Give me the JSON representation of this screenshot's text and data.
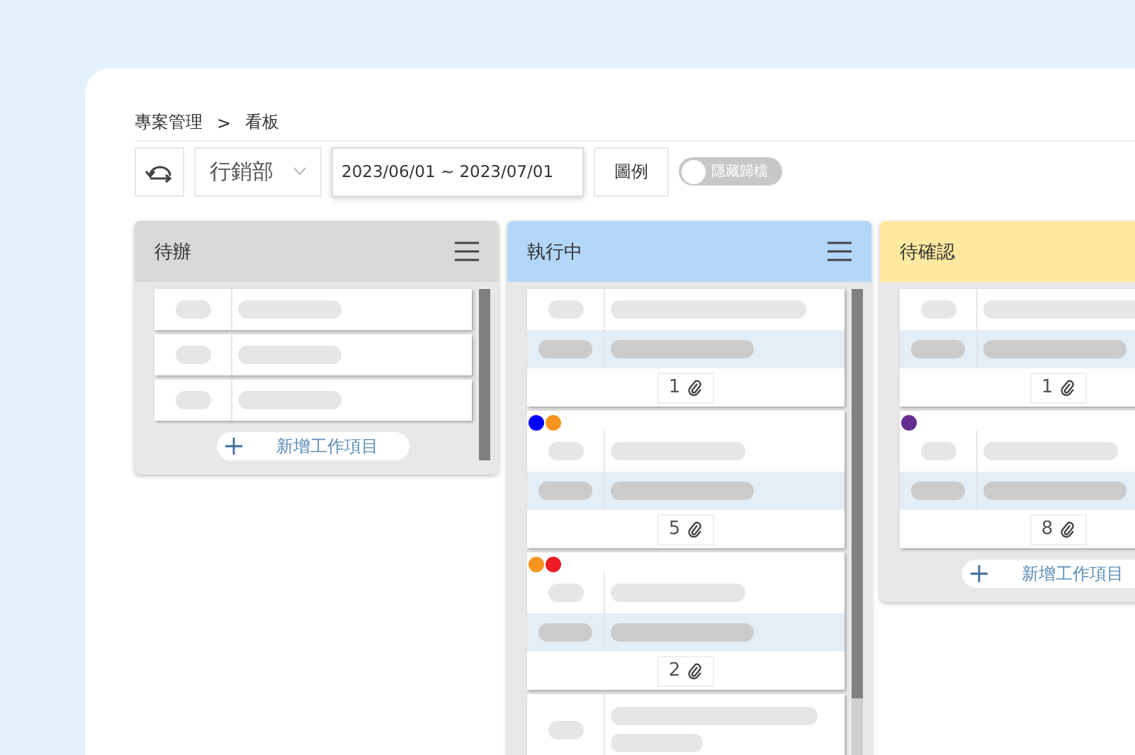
{
  "breadcrumb": {
    "items": [
      "專案管理",
      "看板"
    ],
    "separator": ">"
  },
  "toolbar": {
    "department": "行銷部",
    "date_range": "2023/06/01 ~ 2023/07/01",
    "legend_button": "圖例",
    "archive_toggle": {
      "label": "隱藏歸檔",
      "on": false
    }
  },
  "columns": [
    {
      "title": "待辦",
      "color": "#d9d9d9",
      "add_label": "新增工作項目",
      "cards": [
        {
          "kind": "simple"
        },
        {
          "kind": "simple"
        },
        {
          "kind": "simple"
        }
      ]
    },
    {
      "title": "執行中",
      "color": "#b3d7f8",
      "cards": [
        {
          "kind": "detailed",
          "attachments": "1"
        },
        {
          "kind": "detailed",
          "tags": [
            {
              "color": "#0000ff"
            },
            {
              "color": "#f7941d"
            }
          ],
          "attachments": "5"
        },
        {
          "kind": "detailed",
          "tags": [
            {
              "color": "#f7941d"
            },
            {
              "color": "#ed1c24"
            }
          ],
          "attachments": "2"
        },
        {
          "kind": "partial"
        }
      ]
    },
    {
      "title": "待確認",
      "color": "#ffe9a0",
      "add_label": "新增工作項目",
      "cards": [
        {
          "kind": "detailed",
          "attachments": "1"
        },
        {
          "kind": "detailed",
          "tags": [
            {
              "color": "#662d91"
            }
          ],
          "attachments": "8"
        }
      ]
    }
  ]
}
